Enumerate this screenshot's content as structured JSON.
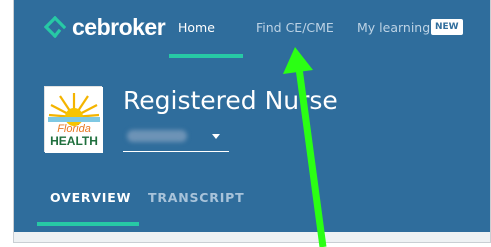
{
  "brand": {
    "name": "cebroker"
  },
  "nav": {
    "items": [
      {
        "label": "Home",
        "active": true
      },
      {
        "label": "Find CE/CME",
        "active": false
      },
      {
        "label": "My learning",
        "active": false
      }
    ],
    "new_badge": "NEW"
  },
  "profile": {
    "title": "Registered Nurse",
    "logo_text_line1": "Florida",
    "logo_text_line2": "HEALTH"
  },
  "tabs": [
    {
      "label": "OVERVIEW",
      "active": true
    },
    {
      "label": "TRANSCRIPT",
      "active": false
    }
  ],
  "colors": {
    "header_bg": "#2f6d9c",
    "accent": "#27c9a5",
    "annotation_arrow": "#2bff14"
  },
  "icons": [
    "cebroker-logo-icon",
    "chevron-down-icon",
    "florida-health-logo",
    "annotation-arrow"
  ]
}
